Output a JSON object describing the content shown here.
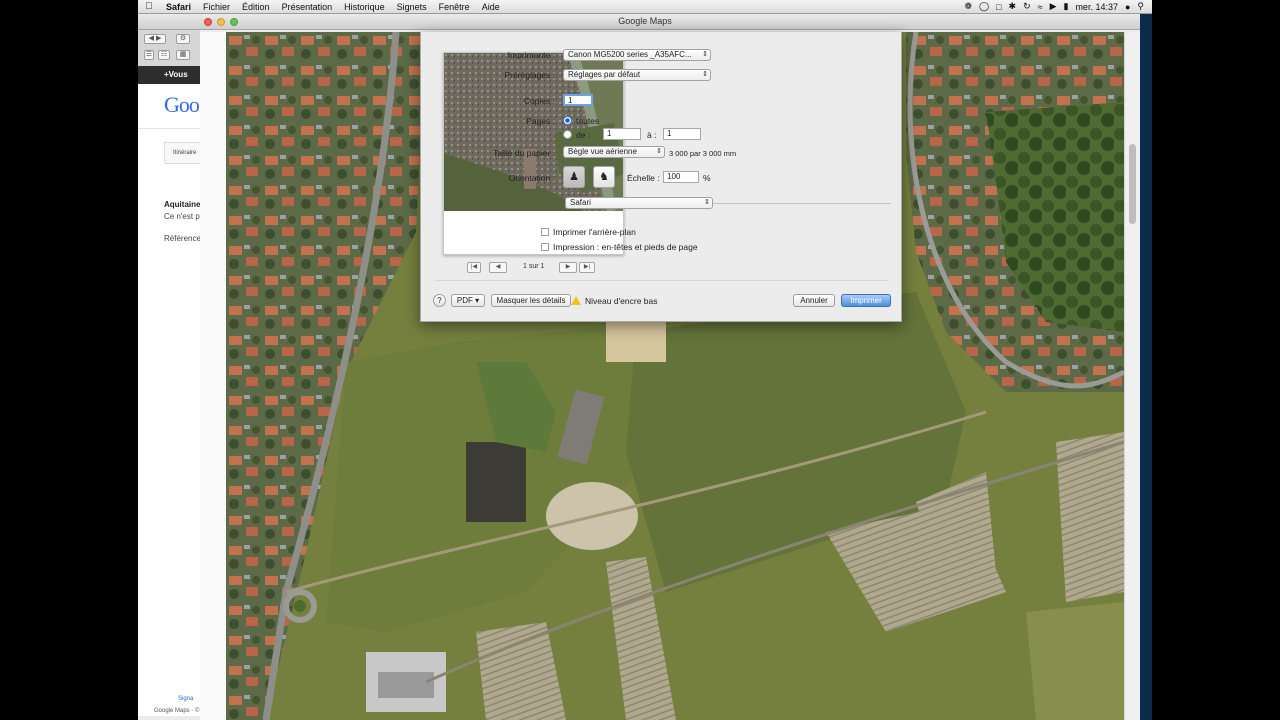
{
  "menubar": {
    "items": [
      "Safari",
      "Fichier",
      "Édition",
      "Présentation",
      "Historique",
      "Signets",
      "Fenêtre",
      "Aide"
    ],
    "clock": "mer. 14:37"
  },
  "window": {
    "title": "Google Maps"
  },
  "google_panel": {
    "bar_text": "+Vous",
    "logo": "Goo",
    "tab": "Itinéraire",
    "result_title": "Aquitaine",
    "result_sub": "Ce n'est p",
    "reference": "Référence",
    "signal": "Signa",
    "footer": "Google Maps - ©"
  },
  "print_dialog": {
    "printer_label": "Imprimante :",
    "printer_value": "Canon MG5200 series _A35AFC...",
    "presets_label": "Préréglages :",
    "presets_value": "Réglages par défaut",
    "copies_label": "Copies :",
    "copies_value": "1",
    "pages_label": "Pages :",
    "pages_all": "toutes",
    "pages_from": "de :",
    "pages_from_value": "1",
    "pages_to": "à :",
    "pages_to_value": "1",
    "paper_label": "Taille du papier :",
    "paper_value": "Bègle vue aérienne",
    "paper_size": "3 000 par 3 000 mm",
    "orientation_label": "Orientation :",
    "scale_label": "Échelle :",
    "scale_value": "100",
    "scale_unit": "%",
    "app_section": "Safari",
    "print_background": "Imprimer l'arrière-plan",
    "print_headers": "Impression : en-têtes et pieds de page",
    "pager_label": "1 sur 1",
    "help": "?",
    "pdf": "PDF",
    "hide_details": "Masquer les détails",
    "ink_warning": "Niveau d'encre bas",
    "cancel": "Annuler",
    "print": "Imprimer"
  },
  "colors": {
    "accent": "#4d8fe0",
    "warning": "#f2c318"
  }
}
